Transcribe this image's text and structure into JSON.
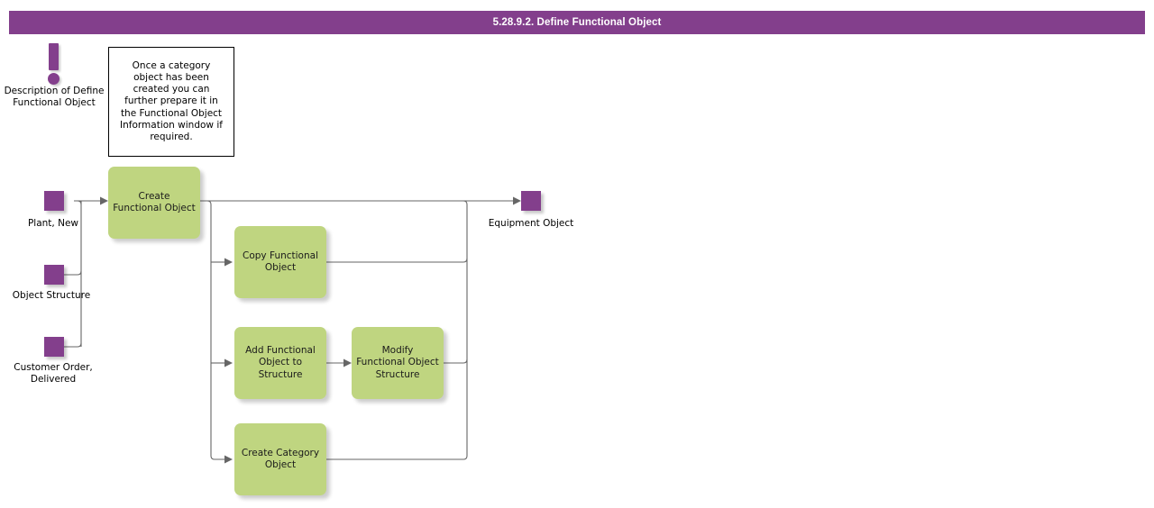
{
  "header": {
    "title": "5.28.9.2. Define Functional Object",
    "bar_color": "#833f8c",
    "text_color": "#ffffff"
  },
  "palette": {
    "purple": "#833f8c",
    "green": "#bfd580",
    "connector": "#666666",
    "note_border": "#000000",
    "background": "#ffffff"
  },
  "description": {
    "icon": "exclamation-mark-icon",
    "label": "Description of Define Functional Object"
  },
  "note": {
    "text": "Once a category object has been created you can further prepare it in the Functional Object Information window if required."
  },
  "inputs": [
    {
      "id": "plant-new",
      "label": "Plant, New"
    },
    {
      "id": "object-structure",
      "label": "Object Structure"
    },
    {
      "id": "customer-order-delivered",
      "label": "Customer Order, Delivered"
    }
  ],
  "processes": [
    {
      "id": "create-functional-object",
      "label": "Create Functional Object"
    },
    {
      "id": "copy-functional-object",
      "label": "Copy Functional Object"
    },
    {
      "id": "add-functional-object-to-structure",
      "label": "Add Functional Object to Structure"
    },
    {
      "id": "modify-functional-object-structure",
      "label": "Modify Functional Object Structure"
    },
    {
      "id": "create-category-object",
      "label": "Create Category Object"
    }
  ],
  "outputs": [
    {
      "id": "equipment-object",
      "label": "Equipment Object"
    }
  ],
  "flows": [
    {
      "from": "plant-new",
      "to": "create-functional-object"
    },
    {
      "from": "object-structure",
      "to": "create-functional-object"
    },
    {
      "from": "customer-order-delivered",
      "to": "create-functional-object"
    },
    {
      "from": "create-functional-object",
      "to": "equipment-object"
    },
    {
      "from": "create-functional-object",
      "to": "copy-functional-object"
    },
    {
      "from": "create-functional-object",
      "to": "add-functional-object-to-structure"
    },
    {
      "from": "create-functional-object",
      "to": "create-category-object"
    },
    {
      "from": "add-functional-object-to-structure",
      "to": "modify-functional-object-structure"
    },
    {
      "from": "copy-functional-object",
      "to": "equipment-object"
    },
    {
      "from": "modify-functional-object-structure",
      "to": "equipment-object"
    },
    {
      "from": "create-category-object",
      "to": "equipment-object"
    }
  ]
}
